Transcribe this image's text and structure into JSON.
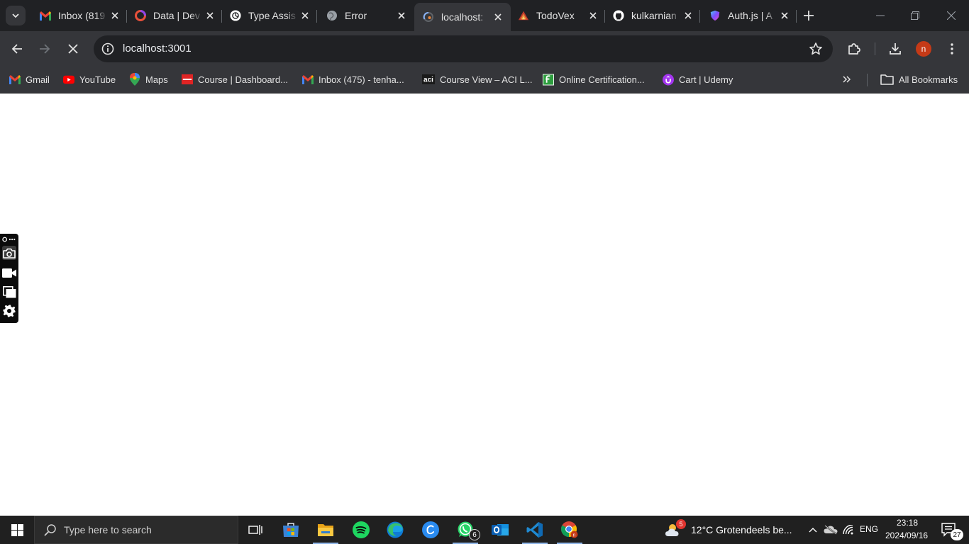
{
  "browser": {
    "tabs": [
      {
        "title": "Inbox (819",
        "icon": "gmail-icon",
        "active": false
      },
      {
        "title": "Data | Dev",
        "icon": "circle-logo-icon",
        "active": false
      },
      {
        "title": "Type Assis",
        "icon": "openai-icon",
        "active": false
      },
      {
        "title": "Error",
        "icon": "globe-icon",
        "active": false
      },
      {
        "title": "localhost:",
        "icon": "loading-globe-icon",
        "active": true
      },
      {
        "title": "TodoVex",
        "icon": "todovex-icon",
        "active": false
      },
      {
        "title": "kulkarnian",
        "icon": "github-icon",
        "active": false
      },
      {
        "title": "Auth.js | A",
        "icon": "authjs-shield-icon",
        "active": false
      }
    ],
    "address": "localhost:3001",
    "profile_initial": "n",
    "bookmarks": [
      {
        "label": "Gmail",
        "icon": "gmail-icon"
      },
      {
        "label": "YouTube",
        "icon": "youtube-icon"
      },
      {
        "label": "Maps",
        "icon": "maps-pin-icon"
      },
      {
        "label": "Course | Dashboard...",
        "icon": "course-red-icon"
      },
      {
        "label": "Inbox (475) - tenha...",
        "icon": "gmail-icon"
      },
      {
        "label": "Course View – ACI L...",
        "icon": "aci-icon"
      },
      {
        "label": "Online Certification...",
        "icon": "certification-green-icon"
      },
      {
        "label": "Cart | Udemy",
        "icon": "udemy-icon"
      }
    ],
    "all_bookmarks_label": "All Bookmarks"
  },
  "taskbar": {
    "search_placeholder": "Type here to search",
    "whatsapp_badge": "6",
    "weather_badge": "5",
    "weather_text": "12°C  Grotendeels be...",
    "language": "ENG",
    "time": "23:18",
    "date": "2024/09/16",
    "notification_count": "27"
  },
  "colors": {
    "tabstrip_bg": "#202124",
    "toolbar_bg": "#35363a",
    "taskbar_bg": "#202020",
    "profile_avatar": "#c53a17"
  }
}
